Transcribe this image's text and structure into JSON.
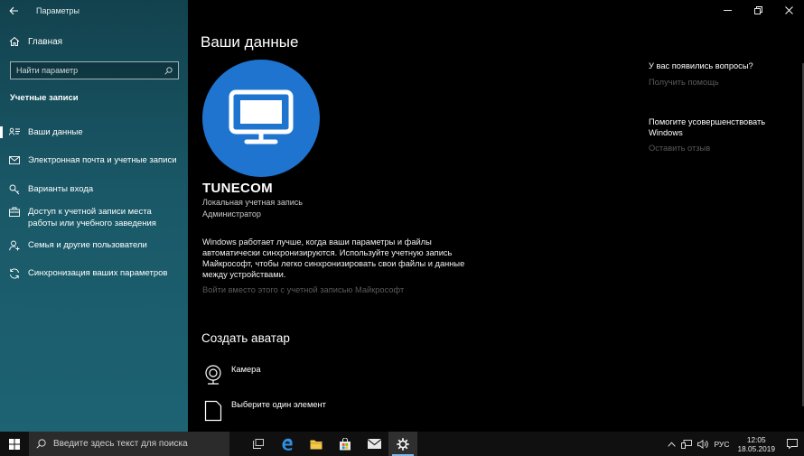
{
  "window": {
    "title": "Параметры"
  },
  "sidebar": {
    "home_label": "Главная",
    "search_placeholder": "Найти параметр",
    "section_title": "Учетные записи",
    "items": [
      {
        "label": "Ваши данные",
        "icon": "person-list-icon",
        "active": true
      },
      {
        "label": "Электронная почта и учетные записи",
        "icon": "mail-icon",
        "active": false
      },
      {
        "label": "Варианты входа",
        "icon": "key-icon",
        "active": false
      },
      {
        "label": "Доступ к учетной записи места работы или учебного заведения",
        "icon": "briefcase-icon",
        "active": false
      },
      {
        "label": "Семья и другие пользователи",
        "icon": "person-add-icon",
        "active": false
      },
      {
        "label": "Синхронизация ваших параметров",
        "icon": "sync-icon",
        "active": false
      }
    ]
  },
  "main": {
    "page_title": "Ваши данные",
    "user": {
      "name": "TUNECOM",
      "account_type": "Локальная учетная запись",
      "role": "Администратор"
    },
    "info_text": "Windows работает лучше, когда ваши параметры и файлы автоматически синхронизируются. Используйте учетную запись Майкрософт, чтобы легко синхронизировать свои файлы и данные между устройствами.",
    "ms_signin_link": "Войти вместо этого с учетной записью Майкрософт",
    "create_avatar": {
      "title": "Создать аватар",
      "options": [
        {
          "label": "Камера",
          "icon": "camera-icon"
        },
        {
          "label": "Выберите один элемент",
          "icon": "file-icon"
        }
      ]
    }
  },
  "help": {
    "question": "У вас появились вопросы?",
    "get_help": "Получить помощь",
    "improve": "Помогите усовершенствовать Windows",
    "feedback": "Оставить отзыв"
  },
  "taskbar": {
    "search_placeholder": "Введите здесь текст для поиска",
    "apps": [
      "task-view-icon",
      "edge-icon",
      "file-explorer-icon",
      "store-icon",
      "mail-icon",
      "settings-icon"
    ],
    "language": "РУС",
    "time": "12:05",
    "date": "18.05.2019"
  },
  "colors": {
    "sidebar_top": "#12424e",
    "sidebar_bottom": "#1d6373",
    "avatar_blue": "#1f74cf",
    "dim_text": "#5a5a5a"
  }
}
